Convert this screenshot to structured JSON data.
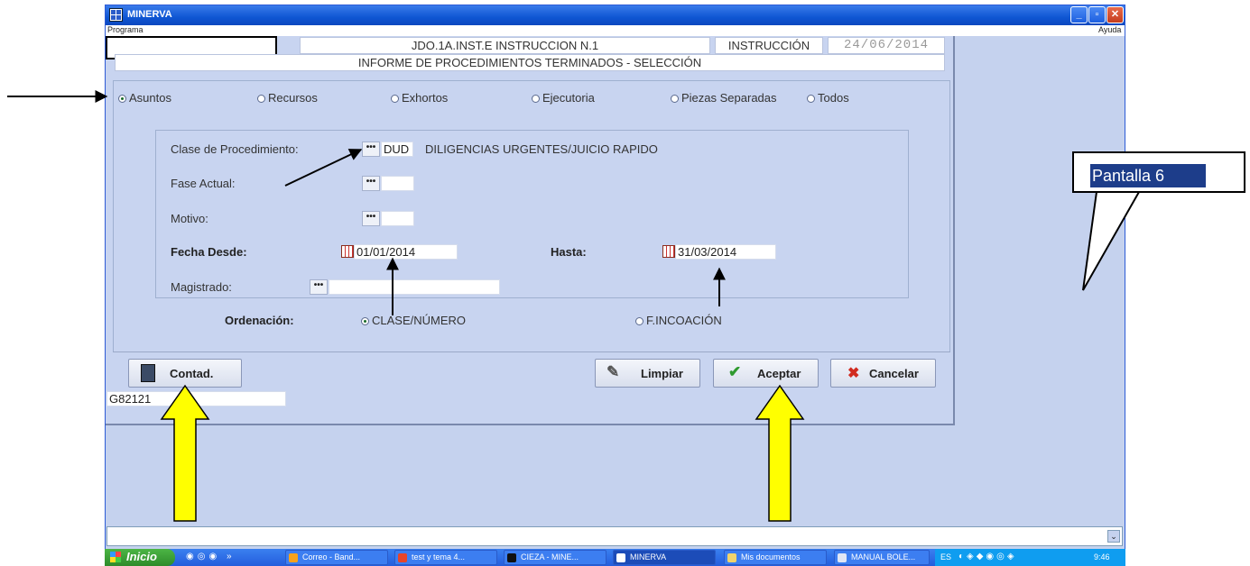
{
  "window": {
    "title": "MINERVA",
    "menu_left": "Programa",
    "menu_right": "Ayuda",
    "min_glyph": "_",
    "max_glyph": "▫",
    "close_glyph": "✕"
  },
  "header": {
    "court": "JDO.1A.INST.E INSTRUCCION N.1",
    "section": "INSTRUCCIÓN",
    "date": "24/06/2014",
    "subtitle": "INFORME DE PROCEDIMIENTOS TERMINADOS - SELECCIÓN"
  },
  "scope_options": [
    {
      "label": "Asuntos",
      "selected": true
    },
    {
      "label": "Recursos",
      "selected": false
    },
    {
      "label": "Exhortos",
      "selected": false
    },
    {
      "label": "Ejecutoria",
      "selected": false
    },
    {
      "label": "Piezas Separadas",
      "selected": false
    },
    {
      "label": "Todos",
      "selected": false
    }
  ],
  "form": {
    "clase_label": "Clase de Procedimiento:",
    "clase_code": "DUD",
    "clase_desc": "DILIGENCIAS URGENTES/JUICIO RAPIDO",
    "fase_label": "Fase Actual:",
    "fase_value": "",
    "motivo_label": "Motivo:",
    "motivo_value": "",
    "fecha_desde_label": "Fecha Desde:",
    "fecha_desde": "01/01/2014",
    "hasta_label": "Hasta:",
    "hasta": "31/03/2014",
    "magistrado_label": "Magistrado:",
    "magistrado_value": "",
    "lookup_glyph": "•••"
  },
  "ordering": {
    "label": "Ordenación:",
    "options": [
      {
        "label": "CLASE/NÚMERO",
        "selected": true
      },
      {
        "label": "F.INCOACIÓN",
        "selected": false
      }
    ]
  },
  "buttons": {
    "contad": "Contad.",
    "limpiar": "Limpiar",
    "aceptar": "Aceptar",
    "cancelar": "Cancelar"
  },
  "user_code": "G82121",
  "annotation": {
    "callout_text": "Pantalla 6"
  },
  "taskbar": {
    "start": "Inicio",
    "tasks": [
      "Correo - Band...",
      "test y tema 4...",
      "CIEZA - MINE...",
      "MINERVA",
      "Mis documentos",
      "MANUAL BOLE..."
    ],
    "tray_lang": "ES",
    "clock": "9:46"
  },
  "colors": {
    "dialog_bg": "#c8d4f0",
    "titlebar": "#0f56d3",
    "yellow_arrow": "#ffff00"
  }
}
